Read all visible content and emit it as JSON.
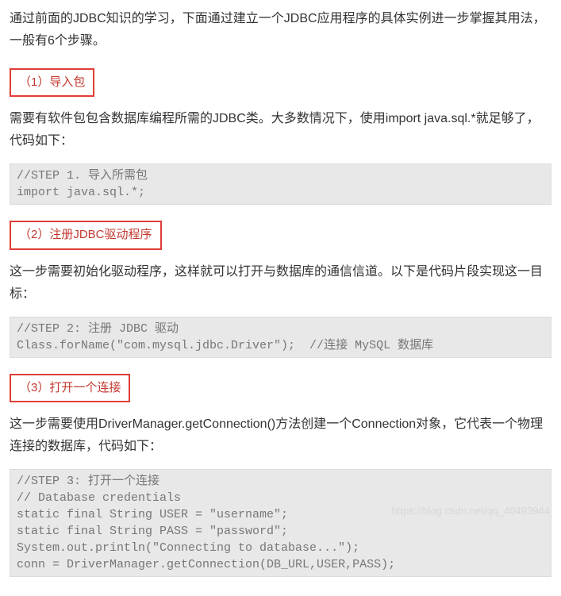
{
  "intro": "通过前面的JDBC知识的学习，下面通过建立一个JDBC应用程序的具体实例进一步掌握其用法，一般有6个步骤。",
  "steps": [
    {
      "title": "（1）导入包",
      "desc": "需要有软件包包含数据库编程所需的JDBC类。大多数情况下，使用import java.sql.*就足够了，代码如下：",
      "code": "//STEP 1. 导入所需包\nimport java.sql.*;"
    },
    {
      "title": "（2）注册JDBC驱动程序",
      "desc": "这一步需要初始化驱动程序，这样就可以打开与数据库的通信信道。以下是代码片段实现这一目标：",
      "code": "//STEP 2: 注册 JDBC 驱动\nClass.forName(\"com.mysql.jdbc.Driver\");  //连接 MySQL 数据库"
    },
    {
      "title": "（3）打开一个连接",
      "desc": "这一步需要使用DriverManager.getConnection()方法创建一个Connection对象，它代表一个物理连接的数据库，代码如下：",
      "code": "//STEP 3: 打开一个连接\n// Database credentials\nstatic final String USER = \"username\";\nstatic final String PASS = \"password\";\nSystem.out.println(\"Connecting to database...\");\nconn = DriverManager.getConnection(DB_URL,USER,PASS);"
    }
  ],
  "watermark": "https://blog.csdn.net/qq_40493944"
}
